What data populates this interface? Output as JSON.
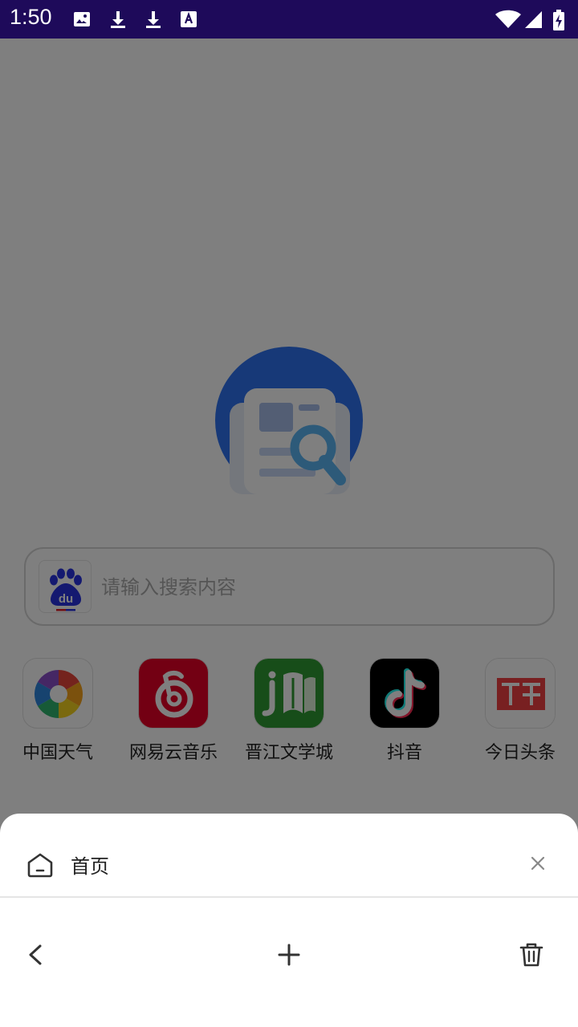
{
  "status_bar": {
    "time": "1:50",
    "background": "#1e0a5a",
    "left_icons": [
      "image-icon",
      "download-icon",
      "download-icon",
      "text-icon"
    ],
    "right_icons": [
      "wifi-icon",
      "signal-icon",
      "battery-charging-icon"
    ]
  },
  "hero": {
    "icon": "news-search-logo",
    "color": "#2f73f0"
  },
  "search": {
    "placeholder": "请输入搜索内容",
    "engine_icon": "baidu-logo"
  },
  "shortcuts": [
    {
      "label": "中国天气",
      "icon": "china-weather-icon"
    },
    {
      "label": "网易云音乐",
      "icon": "netease-music-icon"
    },
    {
      "label": "晋江文学城",
      "icon": "jjwxc-icon"
    },
    {
      "label": "抖音",
      "icon": "douyin-icon"
    },
    {
      "label": "今日头条",
      "icon": "toutiao-icon"
    }
  ],
  "tab_sheet": {
    "tab_title": "首页",
    "tab_icon": "home-icon",
    "actions": [
      "back-icon",
      "plus-icon",
      "trash-icon"
    ]
  }
}
